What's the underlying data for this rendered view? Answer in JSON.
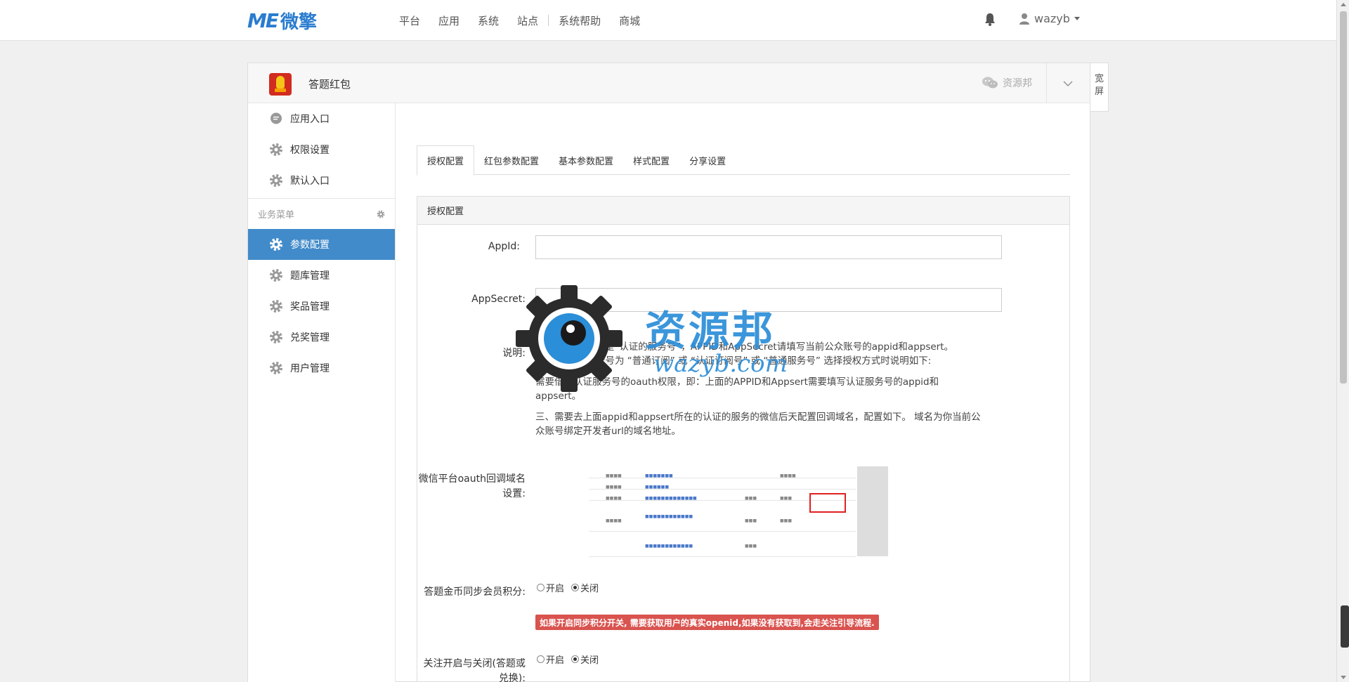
{
  "topbar": {
    "logo_latin": "ME",
    "logo_cn": "微擎",
    "nav": [
      "平台",
      "应用",
      "系统",
      "站点",
      "系统帮助",
      "商城"
    ],
    "username": "wazyb"
  },
  "panel": {
    "app_title": "答题红包",
    "wechat_account": "资源邦",
    "wide_label": "宽屏"
  },
  "sidebar": {
    "top_items": [
      {
        "label": "应用入口",
        "icon": "chat-bubble-icon"
      },
      {
        "label": "权限设置",
        "icon": "gear-icon"
      },
      {
        "label": "默认入口",
        "icon": "gear-icon"
      }
    ],
    "group_title": "业务菜单",
    "menu_items": [
      {
        "label": "参数配置",
        "icon": "gear-icon",
        "active": true
      },
      {
        "label": "题库管理",
        "icon": "gear-icon"
      },
      {
        "label": "奖品管理",
        "icon": "gear-icon"
      },
      {
        "label": "兑奖管理",
        "icon": "gear-icon"
      },
      {
        "label": "用户管理",
        "icon": "gear-icon"
      }
    ]
  },
  "tabs": [
    "授权配置",
    "红包参数配置",
    "基本参数配置",
    "样式配置",
    "分享设置"
  ],
  "form": {
    "section_title": "授权配置",
    "appid_label": "AppId:",
    "appid_value": "",
    "appsecret_label": "AppSecret:",
    "appsecret_value": "",
    "desc_label": "说明:",
    "desc_line1": "一、  当前公众号是“认证的服务号”，APPID和AppSecret请填写当前公众账号的appid和appsert。",
    "desc_line1b": "当前公众账号为 “普通订阅” 或 “认证订阅号” 或 “普通服务号” 选择授权方式时说明如下:",
    "desc_line2": "需要借用认证服务号的oauth权限，即：上面的APPID和Appsert需要填写认证服务号的appid和",
    "desc_line2b": "appsert。",
    "desc_line3": "三、需要去上面appid和appsert所在的认证的服务的微信后天配置回调域名，配置如下。 域名为你当前公",
    "desc_line3b": "众账号绑定开发者url的域名地址。",
    "oauth_label_1": "微信平台oauth回调域名",
    "oauth_label_2": "设置:",
    "sync_label": "答题金币同步会员积分:",
    "radio_on": "开启",
    "radio_off": "关闭",
    "warning": "如果开启同步积分开关, 需要获取用户的真实openid,如果没有获取到,会走关注引导流程.",
    "follow_label_1": "关注开启与关闭(答题或",
    "follow_label_2": "兑换):"
  },
  "watermark": {
    "text": "资源邦",
    "url": "wazyb.com"
  },
  "colors": {
    "brand": "#2a7ccf",
    "active_menu": "#428bca",
    "warning": "#d9534f"
  }
}
